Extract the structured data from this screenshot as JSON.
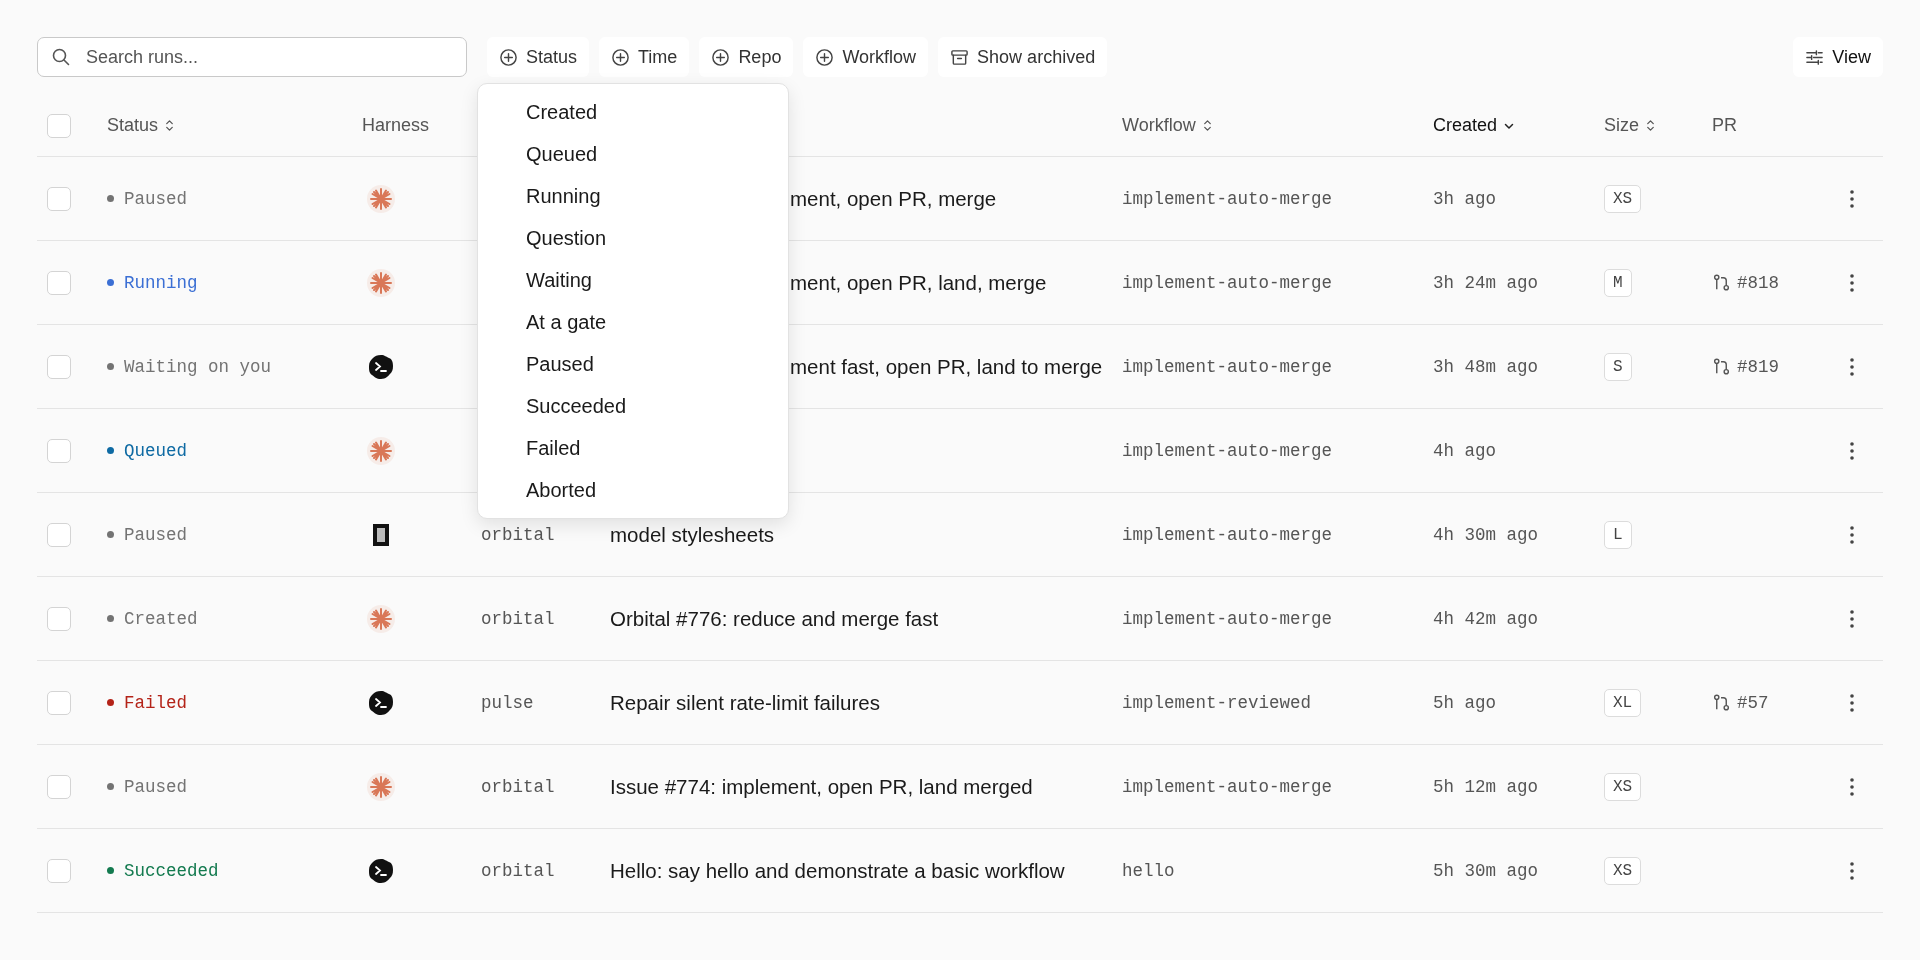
{
  "search": {
    "placeholder": "Search runs..."
  },
  "filters": [
    {
      "label": "Status",
      "kind": "filter"
    },
    {
      "label": "Time",
      "kind": "filter"
    },
    {
      "label": "Repo",
      "kind": "filter"
    },
    {
      "label": "Workflow",
      "kind": "filter"
    },
    {
      "label": "Show archived",
      "kind": "toggle"
    }
  ],
  "view_button": {
    "label": "View"
  },
  "header": {
    "checked": false,
    "status": {
      "label": "Status",
      "sortable": true,
      "sorted": false
    },
    "harness": {
      "label": "Harness",
      "sortable": false,
      "sorted": false
    },
    "workflow": {
      "label": "Workflow",
      "sortable": true,
      "sorted": false
    },
    "created": {
      "label": "Created",
      "sortable": true,
      "sorted": true
    },
    "size": {
      "label": "Size",
      "sortable": true,
      "sorted": false
    },
    "pr": {
      "label": "PR",
      "sortable": false,
      "sorted": false
    }
  },
  "rows": [
    {
      "checked": false,
      "status": "Paused",
      "color": "#737373",
      "harness": {
        "kind": "asterisk"
      },
      "title": "ment, open PR, merge",
      "workflow": "implement-auto-merge",
      "created": "3h ago",
      "size": "XS"
    },
    {
      "checked": false,
      "status": "Running",
      "color": "#3b6fd4",
      "harness": {
        "kind": "asterisk"
      },
      "title": "ment, open PR, land, merge",
      "workflow": "implement-auto-merge",
      "created": "3h 24m ago",
      "size": "M",
      "pr": "#818"
    },
    {
      "checked": false,
      "status": "Waiting on you",
      "color": "#737373",
      "harness": {
        "kind": "terminal"
      },
      "title": "ment fast, open PR, land to merge",
      "workflow": "implement-auto-merge",
      "created": "3h 48m ago",
      "size": "S",
      "pr": "#819"
    },
    {
      "checked": false,
      "status": "Queued",
      "color": "#0e6aa3",
      "harness": {
        "kind": "asterisk"
      },
      "workflow": "implement-auto-merge",
      "created": "4h ago"
    },
    {
      "checked": false,
      "status": "Paused",
      "color": "#737373",
      "harness": {
        "kind": "frame"
      },
      "repo": "orbital",
      "title": "model stylesheets",
      "workflow": "implement-auto-merge",
      "created": "4h 30m ago",
      "size": "L"
    },
    {
      "checked": false,
      "status": "Created",
      "color": "#737373",
      "harness": {
        "kind": "asterisk"
      },
      "repo": "orbital",
      "title": "Orbital #776: reduce and merge fast",
      "workflow": "implement-auto-merge",
      "created": "4h 42m ago"
    },
    {
      "checked": false,
      "status": "Failed",
      "color": "#b42318",
      "harness": {
        "kind": "terminal"
      },
      "repo": "pulse",
      "title": "Repair silent rate-limit failures",
      "workflow": "implement-reviewed",
      "created": "5h ago",
      "size": "XL",
      "pr": "#57"
    },
    {
      "checked": false,
      "status": "Paused",
      "color": "#737373",
      "harness": {
        "kind": "asterisk"
      },
      "repo": "orbital",
      "title": "Issue #774: implement, open PR, land merged",
      "workflow": "implement-auto-merge",
      "created": "5h 12m ago",
      "size": "XS"
    },
    {
      "checked": false,
      "status": "Succeeded",
      "color": "#137a4f",
      "harness": {
        "kind": "terminal"
      },
      "repo": "orbital",
      "title": "Hello: say hello and demonstrate a basic workflow",
      "workflow": "hello",
      "created": "5h 30m ago",
      "size": "XS"
    }
  ],
  "status_menu": {
    "items": [
      "Created",
      "Queued",
      "Running",
      "Question",
      "Waiting",
      "At a gate",
      "Paused",
      "Succeeded",
      "Failed",
      "Aborted"
    ]
  }
}
